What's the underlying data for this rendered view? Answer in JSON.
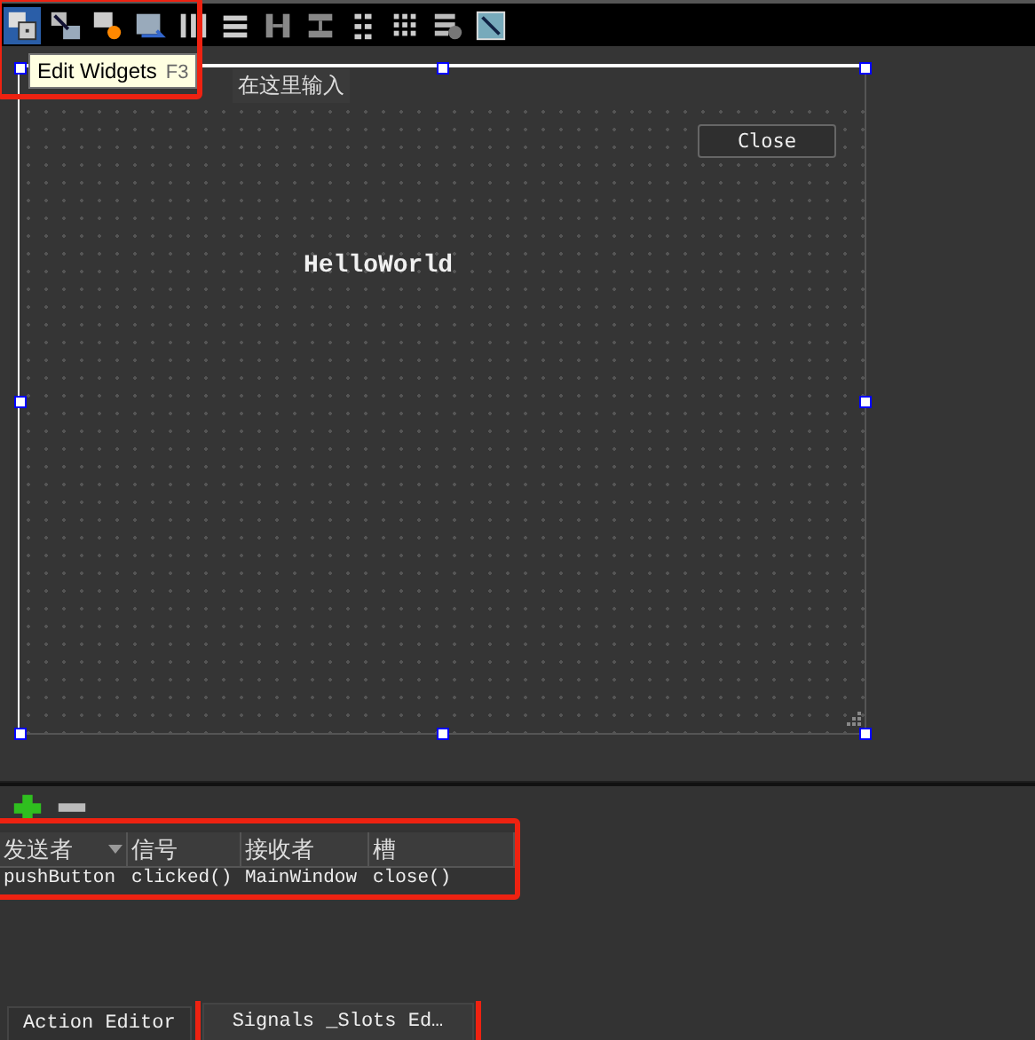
{
  "toolbar": {
    "tools": [
      {
        "kind": "edit-widgets",
        "selected": true
      },
      {
        "kind": "edit-signals",
        "selected": false
      },
      {
        "kind": "edit-buddies",
        "selected": false
      },
      {
        "kind": "edit-tab-order",
        "selected": false
      },
      {
        "kind": "hlayout",
        "selected": false
      },
      {
        "kind": "vlayout",
        "selected": false
      },
      {
        "kind": "hsplit",
        "selected": false
      },
      {
        "kind": "vsplit",
        "selected": false
      },
      {
        "kind": "form-layout",
        "selected": false
      },
      {
        "kind": "grid-layout",
        "selected": false
      },
      {
        "kind": "break-layout",
        "selected": false
      },
      {
        "kind": "adjust-size",
        "selected": false
      }
    ]
  },
  "tooltip": {
    "text": "Edit Widgets",
    "shortcut": "F3"
  },
  "form": {
    "menu_items": [
      "在这里输入"
    ],
    "button": "Close",
    "label": "HelloWorld"
  },
  "connections": {
    "columns": [
      "发送者",
      "信号",
      "接收者",
      "槽"
    ],
    "rows": [
      [
        "pushButton",
        "clicked()",
        "MainWindow",
        "close()"
      ]
    ]
  },
  "bottom_tabs": [
    {
      "label": "Action Editor",
      "selected": false
    },
    {
      "label": "Signals _Slots Ed…",
      "selected": true
    }
  ]
}
